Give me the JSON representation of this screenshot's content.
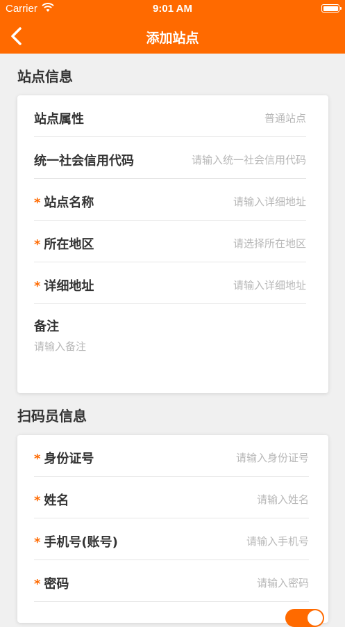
{
  "status_bar": {
    "carrier": "Carrier",
    "time": "9:01 AM"
  },
  "nav": {
    "title": "添加站点",
    "back_icon": "chevron-left-icon"
  },
  "site_section": {
    "title": "站点信息",
    "rows": [
      {
        "label": "站点属性",
        "required": false,
        "value": "普通站点"
      },
      {
        "label": "统一社会信用代码",
        "required": false,
        "value": "请输入统一社会信用代码"
      },
      {
        "label": "站点名称",
        "required": true,
        "value": "请输入详细地址"
      },
      {
        "label": "所在地区",
        "required": true,
        "value": "请选择所在地区"
      },
      {
        "label": "详细地址",
        "required": true,
        "value": "请输入详细地址"
      }
    ],
    "remark": {
      "label": "备注",
      "placeholder": "请输入备注"
    }
  },
  "scanner_section": {
    "title": "扫码员信息",
    "rows": [
      {
        "label": "身份证号",
        "required": true,
        "value": "请输入身份证号"
      },
      {
        "label": "姓名",
        "required": true,
        "value": "请输入姓名"
      },
      {
        "label": "手机号(账号)",
        "required": true,
        "value": "请输入手机号"
      },
      {
        "label": "密码",
        "required": true,
        "value": "请输入密码"
      }
    ],
    "required_mark": "*"
  },
  "colors": {
    "accent": "#ff6a00",
    "background": "#f0f0f0"
  }
}
